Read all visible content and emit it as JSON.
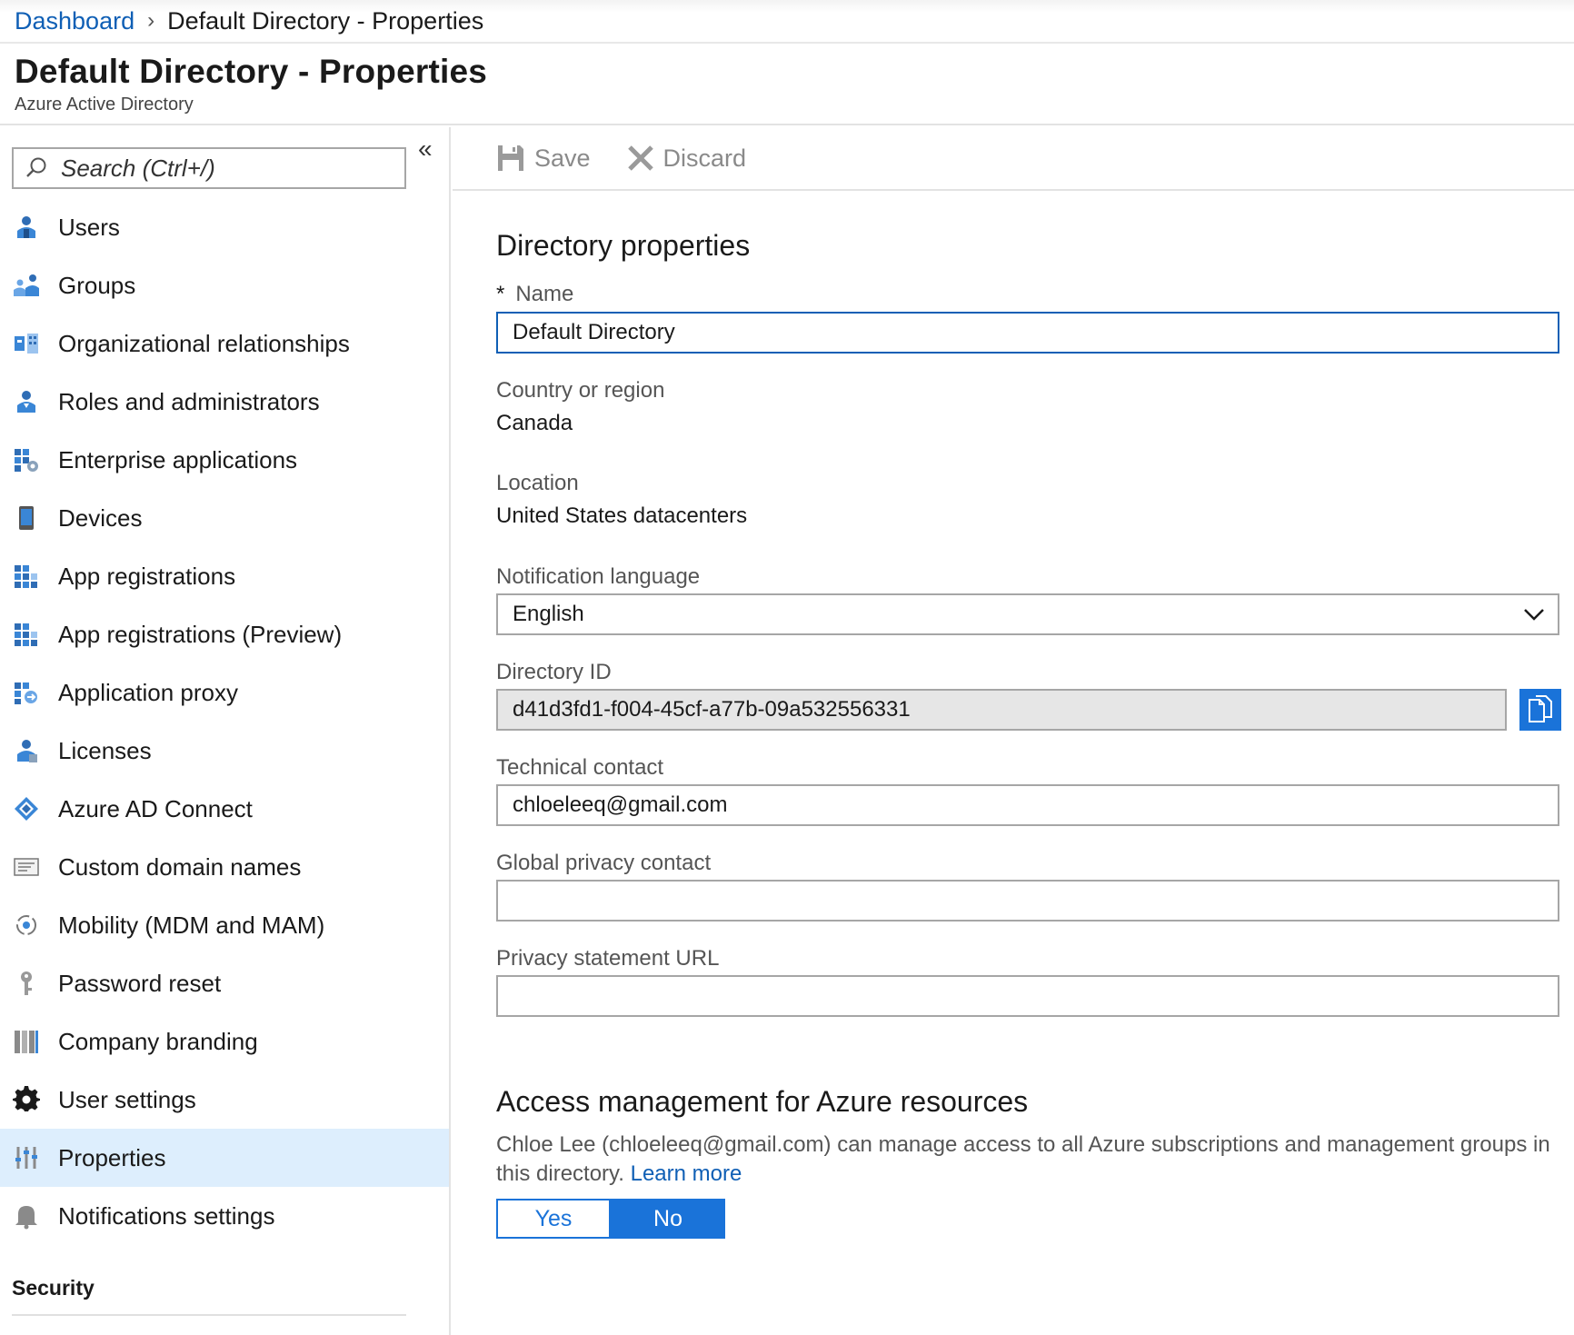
{
  "breadcrumb": {
    "link": "Dashboard",
    "current": "Default Directory - Properties"
  },
  "header": {
    "title": "Default Directory - Properties",
    "subtitle": "Azure Active Directory"
  },
  "sidebar": {
    "collapse_glyph": "«",
    "search_placeholder": "Search (Ctrl+/)",
    "items": [
      {
        "label": "Users",
        "icon": "user-icon"
      },
      {
        "label": "Groups",
        "icon": "group-icon"
      },
      {
        "label": "Organizational relationships",
        "icon": "org-relationships-icon"
      },
      {
        "label": "Roles and administrators",
        "icon": "roles-icon"
      },
      {
        "label": "Enterprise applications",
        "icon": "enterprise-apps-icon"
      },
      {
        "label": "Devices",
        "icon": "device-icon"
      },
      {
        "label": "App registrations",
        "icon": "app-grid-icon"
      },
      {
        "label": "App registrations (Preview)",
        "icon": "app-grid-icon"
      },
      {
        "label": "Application proxy",
        "icon": "app-proxy-icon"
      },
      {
        "label": "Licenses",
        "icon": "license-icon"
      },
      {
        "label": "Azure AD Connect",
        "icon": "diamond-connect-icon"
      },
      {
        "label": "Custom domain names",
        "icon": "domain-card-icon"
      },
      {
        "label": "Mobility (MDM and MAM)",
        "icon": "mobility-icon"
      },
      {
        "label": "Password reset",
        "icon": "key-icon"
      },
      {
        "label": "Company branding",
        "icon": "branding-icon"
      },
      {
        "label": "User settings",
        "icon": "gear-icon"
      },
      {
        "label": "Properties",
        "icon": "properties-sliders-icon",
        "active": true
      },
      {
        "label": "Notifications settings",
        "icon": "bell-icon"
      }
    ],
    "section_label": "Security"
  },
  "toolbar": {
    "save_label": "Save",
    "discard_label": "Discard"
  },
  "form": {
    "section_title": "Directory properties",
    "required_marker": "*",
    "name_label": "Name",
    "name_value": "Default Directory",
    "country_label": "Country or region",
    "country_value": "Canada",
    "location_label": "Location",
    "location_value": "United States datacenters",
    "notif_lang_label": "Notification language",
    "notif_lang_value": "English",
    "dir_id_label": "Directory ID",
    "dir_id_value": "d41d3fd1-f004-45cf-a77b-09a532556331",
    "tech_contact_label": "Technical contact",
    "tech_contact_value": "chloeleeq@gmail.com",
    "privacy_contact_label": "Global privacy contact",
    "privacy_contact_value": "",
    "privacy_url_label": "Privacy statement URL",
    "privacy_url_value": ""
  },
  "access": {
    "title": "Access management for Azure resources",
    "description": "Chloe Lee (chloeleeq@gmail.com) can manage access to all Azure subscriptions and management groups in this directory.",
    "learn_more": "Learn more",
    "yes_label": "Yes",
    "no_label": "No",
    "selected": "No"
  },
  "colors": {
    "accent": "#1a73d9",
    "link": "#0f5fb5",
    "active_nav_bg": "#ddeefd"
  }
}
